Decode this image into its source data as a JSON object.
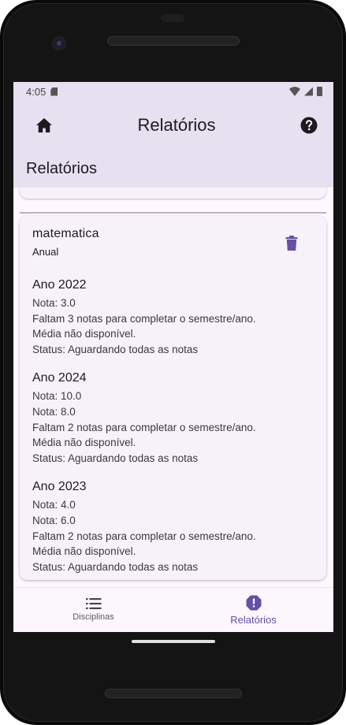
{
  "status_bar": {
    "time": "4:05"
  },
  "app_bar": {
    "title": "Relatórios"
  },
  "page": {
    "title": "Relatórios"
  },
  "report": {
    "subject": "matematica",
    "period": "Anual",
    "years": [
      {
        "title": "Ano 2022",
        "lines": [
          "Nota: 3.0",
          "Faltam 3 notas para completar o semestre/ano.",
          "Média não disponível.",
          "Status: Aguardando todas as notas"
        ]
      },
      {
        "title": "Ano 2024",
        "lines": [
          "Nota: 10.0",
          "Nota: 8.0",
          "Faltam 2 notas para completar o semestre/ano.",
          "Média não disponível.",
          "Status: Aguardando todas as notas"
        ]
      },
      {
        "title": "Ano 2023",
        "lines": [
          "Nota: 4.0",
          "Nota: 6.0",
          "Faltam 2 notas para completar o semestre/ano.",
          "Média não disponível.",
          "Status: Aguardando todas as notas"
        ]
      }
    ]
  },
  "bottom_nav": {
    "items": [
      {
        "label": "Disciplinas",
        "icon": "list-icon",
        "active": false
      },
      {
        "label": "Relatórios",
        "icon": "report-alert-icon",
        "active": true
      }
    ]
  },
  "colors": {
    "app_bar_bg": "#e7e0f0",
    "accent": "#6750a4",
    "card_bg": "#f7f2fa"
  }
}
